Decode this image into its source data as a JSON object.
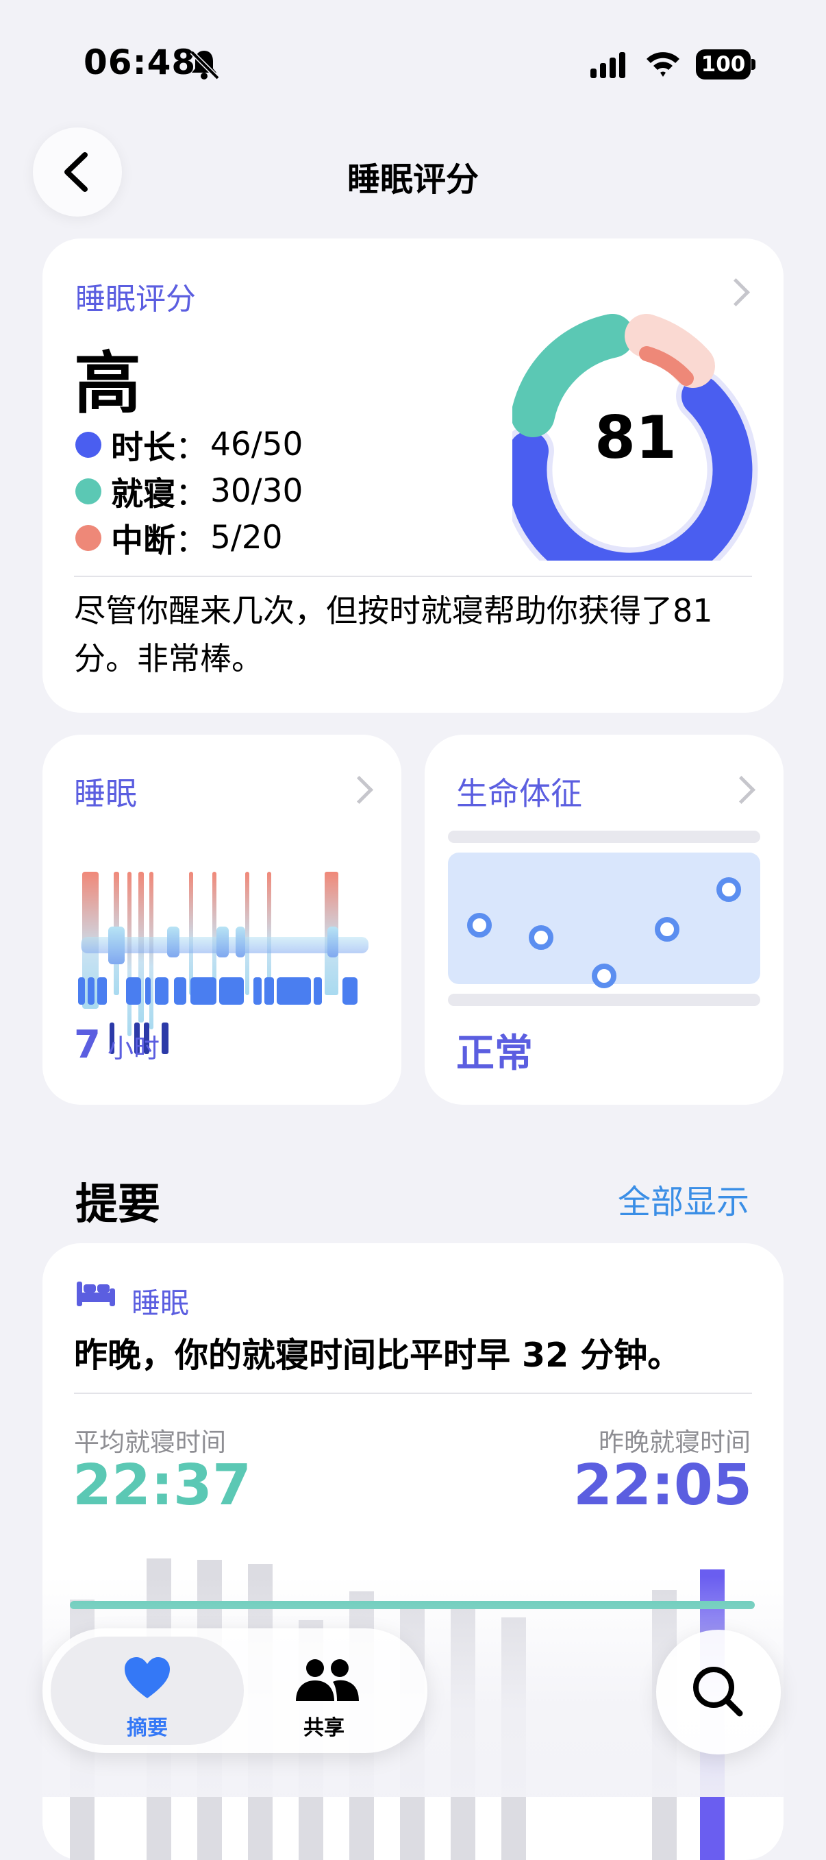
{
  "status_bar": {
    "time": "06:48",
    "battery": "100",
    "icons": [
      "bell-slash-icon",
      "signal-icon",
      "wifi-icon",
      "battery-icon"
    ]
  },
  "nav": {
    "title": "睡眠评分",
    "back_icon": "chevron-left-icon"
  },
  "score_card": {
    "label": "睡眠评分",
    "level": "高",
    "score": "81",
    "metrics": [
      {
        "label": "时长",
        "sep": "：",
        "value": "46/50",
        "color": "#4a5ef0"
      },
      {
        "label": "就寝",
        "sep": "：",
        "value": "30/30",
        "color": "#5bc8b4"
      },
      {
        "label": "中断",
        "sep": "：",
        "value": "5/20",
        "color": "#ee8878"
      }
    ],
    "description": "尽管你醒来几次，但按时就寝帮助你获得了81分。非常棒。"
  },
  "sleep_card": {
    "title": "睡眠",
    "value": "7",
    "unit": "小时"
  },
  "vitals_card": {
    "title": "生命体征",
    "value": "正常"
  },
  "summary": {
    "title": "提要",
    "show_all": "全部显示",
    "card": {
      "category": "睡眠",
      "text": "昨晚，你的就寝时间比平时早 32 分钟。",
      "avg_label": "平均就寝时间",
      "avg_time": "22:37",
      "last_label": "昨晚就寝时间",
      "last_time": "22:05"
    }
  },
  "tabbar": {
    "tabs": [
      {
        "label": "摘要",
        "icon": "heart-icon",
        "active": true
      },
      {
        "label": "共享",
        "icon": "people-icon",
        "active": false
      }
    ],
    "search_icon": "search-icon"
  },
  "colors": {
    "accent": "#5b5ee0",
    "teal": "#5bc8b4",
    "blue": "#4a5ef0",
    "salmon": "#ee8878",
    "link": "#3a8ee6"
  }
}
